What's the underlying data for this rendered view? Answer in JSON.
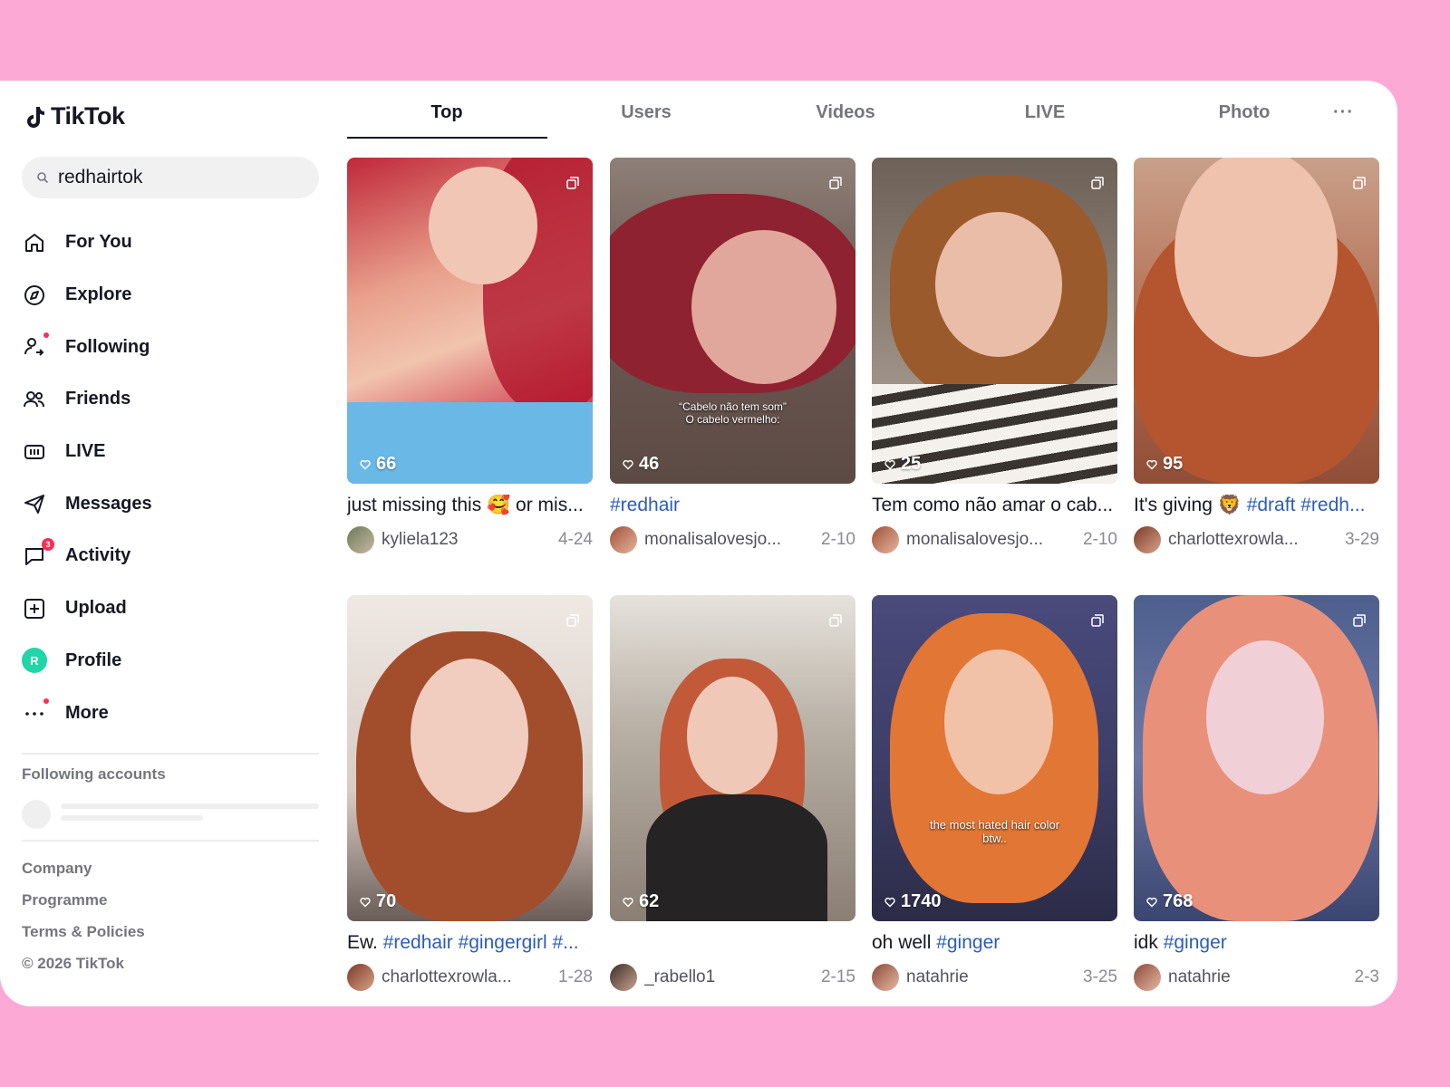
{
  "app": {
    "logo_text": "TikTok"
  },
  "search": {
    "value": "redhairtok"
  },
  "nav": [
    {
      "label": "For You",
      "icon": "home-icon"
    },
    {
      "label": "Explore",
      "icon": "compass-icon"
    },
    {
      "label": "Following",
      "icon": "following-icon"
    },
    {
      "label": "Friends",
      "icon": "friends-icon"
    },
    {
      "label": "LIVE",
      "icon": "live-icon"
    },
    {
      "label": "Messages",
      "icon": "send-icon"
    },
    {
      "label": "Activity",
      "icon": "activity-icon",
      "badge": "3"
    },
    {
      "label": "Upload",
      "icon": "upload-icon"
    },
    {
      "label": "Profile",
      "icon": "profile-avatar",
      "avatar_letter": "R"
    },
    {
      "label": "More",
      "icon": "more-icon"
    }
  ],
  "following_accounts": {
    "title": "Following accounts"
  },
  "footer": [
    "Company",
    "Programme",
    "Terms & Policies",
    "© 2026 TikTok"
  ],
  "tabs": [
    "Top",
    "Users",
    "Videos",
    "LIVE",
    "Photo"
  ],
  "tabs_more": "···",
  "active_tab": "Top",
  "results": [
    {
      "likes": "66",
      "caption_parts": [
        {
          "t": "just missing this 🥰  or mis..."
        }
      ],
      "user": "kyliela123",
      "date": "4-24"
    },
    {
      "likes": "46",
      "caption_parts": [
        {
          "t": "#redhair",
          "tag": true
        }
      ],
      "user": "monalisalovesjo...",
      "date": "2-10",
      "overlay": "“Cabelo não tem som”\nO cabelo vermelho:"
    },
    {
      "likes": "25",
      "caption_parts": [
        {
          "t": "Tem como não amar o cab..."
        }
      ],
      "user": "monalisalovesjo...",
      "date": "2-10"
    },
    {
      "likes": "95",
      "caption_parts": [
        {
          "t": "It's giving 🦁  "
        },
        {
          "t": "#draft #redh...",
          "tag": true
        }
      ],
      "user": "charlottexrowla...",
      "date": "3-29"
    },
    {
      "likes": "70",
      "caption_parts": [
        {
          "t": "Ew. "
        },
        {
          "t": "#redhair #gingergirl #...",
          "tag": true
        }
      ],
      "user": "charlottexrowla...",
      "date": "1-28"
    },
    {
      "likes": "62",
      "caption_parts": [],
      "user": "_rabello1",
      "date": "2-15"
    },
    {
      "likes": "1740",
      "caption_parts": [
        {
          "t": "oh well "
        },
        {
          "t": "#ginger",
          "tag": true
        }
      ],
      "user": "natahrie",
      "date": "3-25",
      "overlay": "the most hated hair color\nbtw.."
    },
    {
      "likes": "768",
      "caption_parts": [
        {
          "t": "idk "
        },
        {
          "t": "#ginger",
          "tag": true
        }
      ],
      "user": "natahrie",
      "date": "2-3"
    }
  ],
  "colors": {
    "background": "#fda9d5",
    "accent": "#fe2c55",
    "hashtag": "#2b5db9",
    "profile_avatar": "#20d5a8"
  }
}
